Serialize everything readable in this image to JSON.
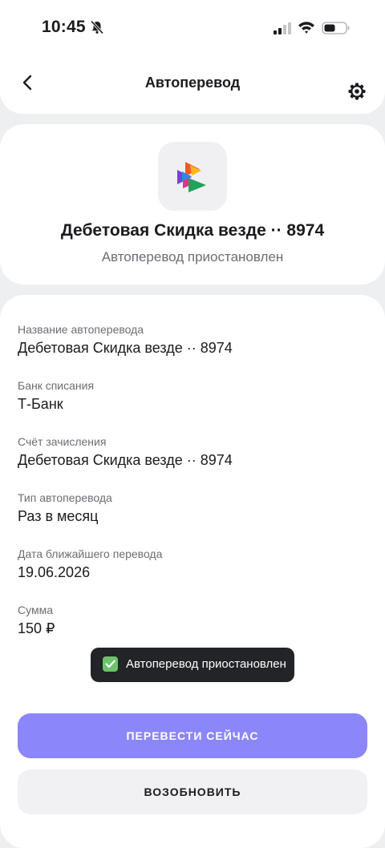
{
  "status_bar": {
    "time": "10:45",
    "icons": [
      "bell-slash-icon",
      "signal-icon",
      "wifi-icon",
      "battery-icon"
    ]
  },
  "header": {
    "title": "Автоперевод",
    "back_icon": "chevron-left-icon",
    "settings_icon": "gear-icon"
  },
  "account": {
    "logo_icon": "bank-logo-icon",
    "title": "Дебетовая Скидка везде ·· 8974",
    "status": "Автоперевод приостановлен"
  },
  "details": [
    {
      "label": "Название автоперевода",
      "value": "Дебетовая Скидка везде ·· 8974"
    },
    {
      "label": "Банк списания",
      "value": "Т-Банк"
    },
    {
      "label": "Счёт зачисления",
      "value": "Дебетовая Скидка везде ·· 8974"
    },
    {
      "label": "Тип автоперевода",
      "value": "Раз в месяц"
    },
    {
      "label": "Дата ближайшего перевода",
      "value": "19.06.2026"
    },
    {
      "label": "Сумма",
      "value": "150 ₽"
    }
  ],
  "toast": {
    "icon": "check-icon",
    "text": "Автоперевод приостановлен"
  },
  "actions": {
    "transfer_now": "ПЕРЕВЕСТИ СЕЙЧАС",
    "resume": "ВОЗОБНОВИТЬ"
  },
  "colors": {
    "primary": "#8b86fa",
    "toast_bg": "#222427",
    "toast_check": "#6cc36c",
    "page_bg": "#eeeff1"
  }
}
